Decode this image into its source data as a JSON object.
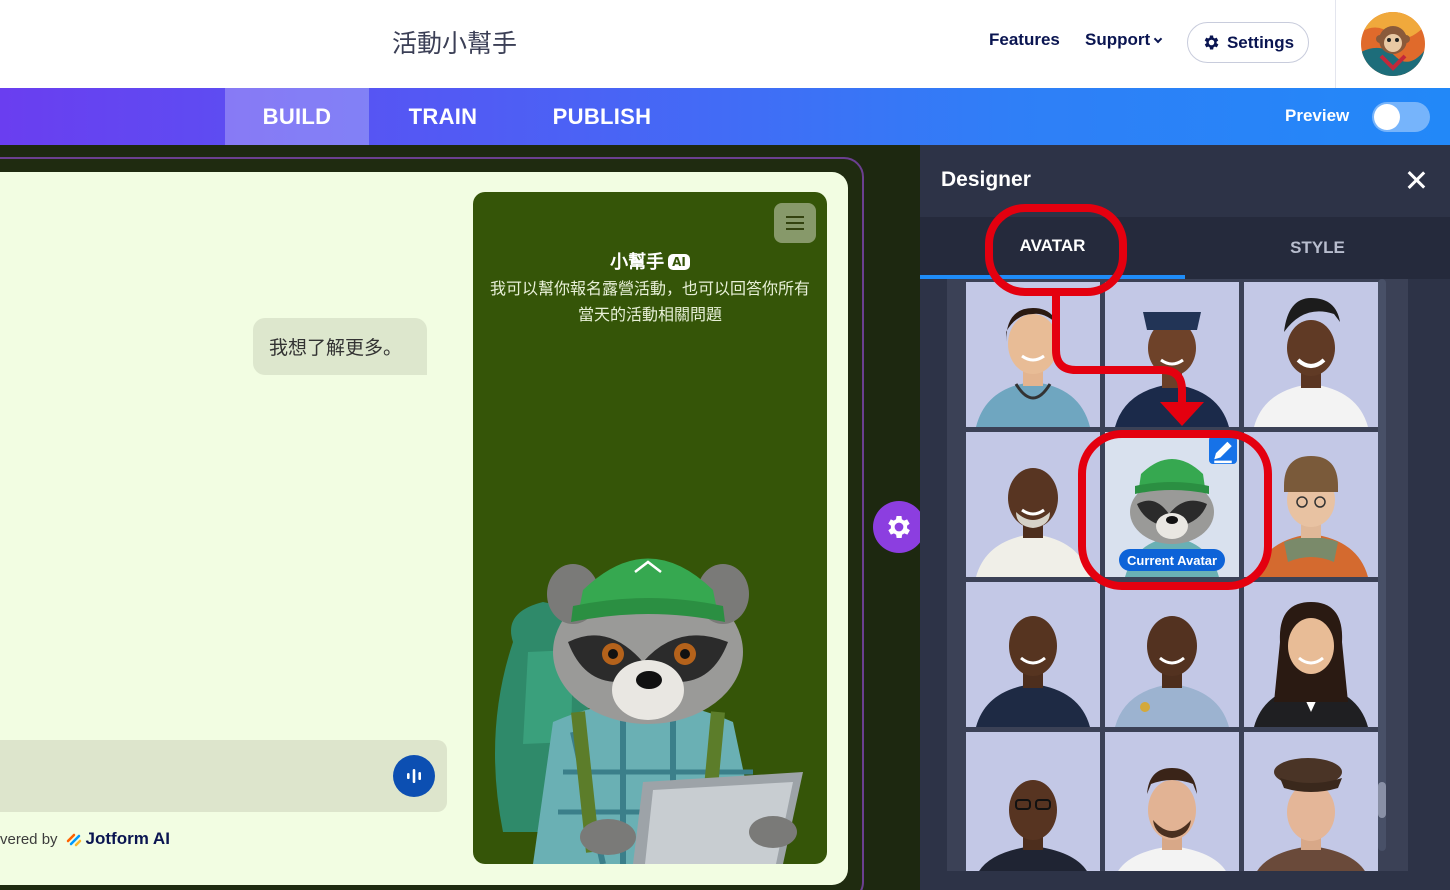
{
  "header": {
    "app_title": "活動小幫手",
    "features": "Features",
    "support": "Support",
    "settings": "Settings"
  },
  "tabs": {
    "build": "BUILD",
    "train": "TRAIN",
    "publish": "PUBLISH",
    "preview": "Preview",
    "active": "BUILD",
    "preview_on": false
  },
  "chat": {
    "user_message": "我想了解更多。",
    "powered_by": "vered by",
    "brand": "Jotform AI"
  },
  "agent": {
    "name": "小幫手",
    "badge": "AI",
    "description": "我可以幫你報名露營活動，也可以回答你所有當天的活動相關問題"
  },
  "designer": {
    "title": "Designer",
    "tab_avatar": "AVATAR",
    "tab_style": "STYLE",
    "active_tab": "AVATAR",
    "current_avatar_label": "Current Avatar",
    "avatars": [
      "nurse-woman",
      "flight-attendant-woman",
      "service-woman",
      "priest-man",
      "raccoon-camper",
      "hiker-woman",
      "police-man",
      "security-officer-man",
      "business-woman",
      "business-man-glasses",
      "smiling-man",
      "artist-man-beret"
    ],
    "selected_index": 4
  },
  "colors": {
    "accent": "#1f8cf8",
    "fab": "#8c3ee0",
    "card_green": "#355508",
    "panel_bg": "#f2fde2",
    "annotation_red": "#e4000f"
  }
}
